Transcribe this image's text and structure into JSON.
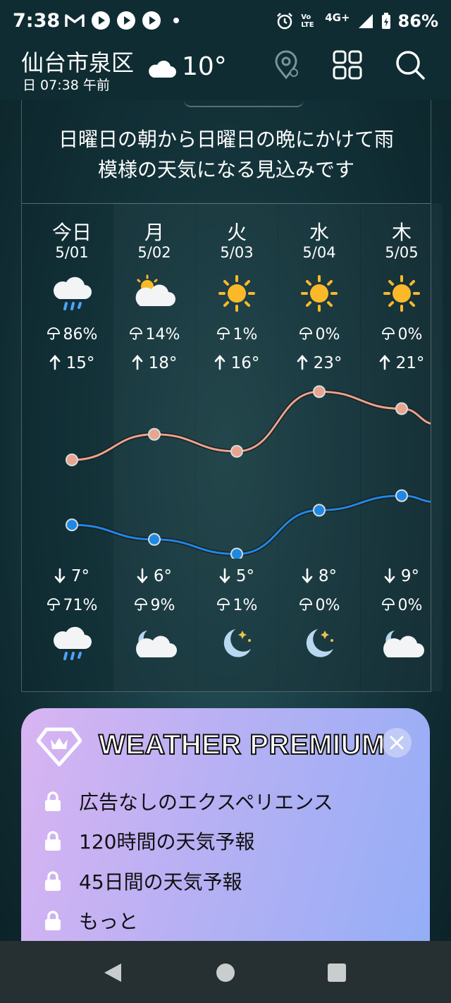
{
  "status_bar": {
    "time": "7:38",
    "signal_label": "4G+",
    "volte_label": "Vo LTE",
    "battery": "86%",
    "notification_icons": [
      "gmail-icon",
      "play-icon",
      "play-icon",
      "play-icon"
    ]
  },
  "header": {
    "location": "仙台市泉区",
    "local_time": "日 07:38 午前",
    "current_temp": "10°",
    "current_condition_icon": "cloud-icon"
  },
  "forecast": {
    "summary_line1": "日曜日の朝から日曜日の晩にかけて雨",
    "summary_line2": "模様の天気になる見込みです",
    "days": [
      {
        "label": "今日",
        "date": "5/01",
        "day_icon": "cloud-rain-icon",
        "day_precip": "86%",
        "high": "15°",
        "low": "7°",
        "night_precip": "71%",
        "night_icon": "cloud-rain-icon"
      },
      {
        "label": "月",
        "date": "5/02",
        "day_icon": "sun-cloud-icon",
        "day_precip": "14%",
        "high": "18°",
        "low": "6°",
        "night_precip": "9%",
        "night_icon": "moon-cloud-icon"
      },
      {
        "label": "火",
        "date": "5/03",
        "day_icon": "sun-icon",
        "day_precip": "1%",
        "high": "16°",
        "low": "5°",
        "night_precip": "1%",
        "night_icon": "moon-icon"
      },
      {
        "label": "水",
        "date": "5/04",
        "day_icon": "sun-icon",
        "day_precip": "0%",
        "high": "23°",
        "low": "8°",
        "night_precip": "0%",
        "night_icon": "moon-icon"
      },
      {
        "label": "木",
        "date": "5/05",
        "day_icon": "sun-icon",
        "day_precip": "0%",
        "high": "21°",
        "low": "9°",
        "night_precip": "0%",
        "night_icon": "moon-cloud-icon"
      }
    ],
    "high_values": [
      15,
      18,
      16,
      23,
      21
    ],
    "low_values": [
      7,
      6,
      5,
      8,
      9
    ],
    "high_line_color": "#e8a48e",
    "low_line_color": "#1e88e5"
  },
  "premium": {
    "title": "WEATHER PREMIUM",
    "items": [
      "広告なしのエクスペリエンス",
      "120時間の天気予報",
      "45日間の天気予報",
      "もっと"
    ]
  }
}
